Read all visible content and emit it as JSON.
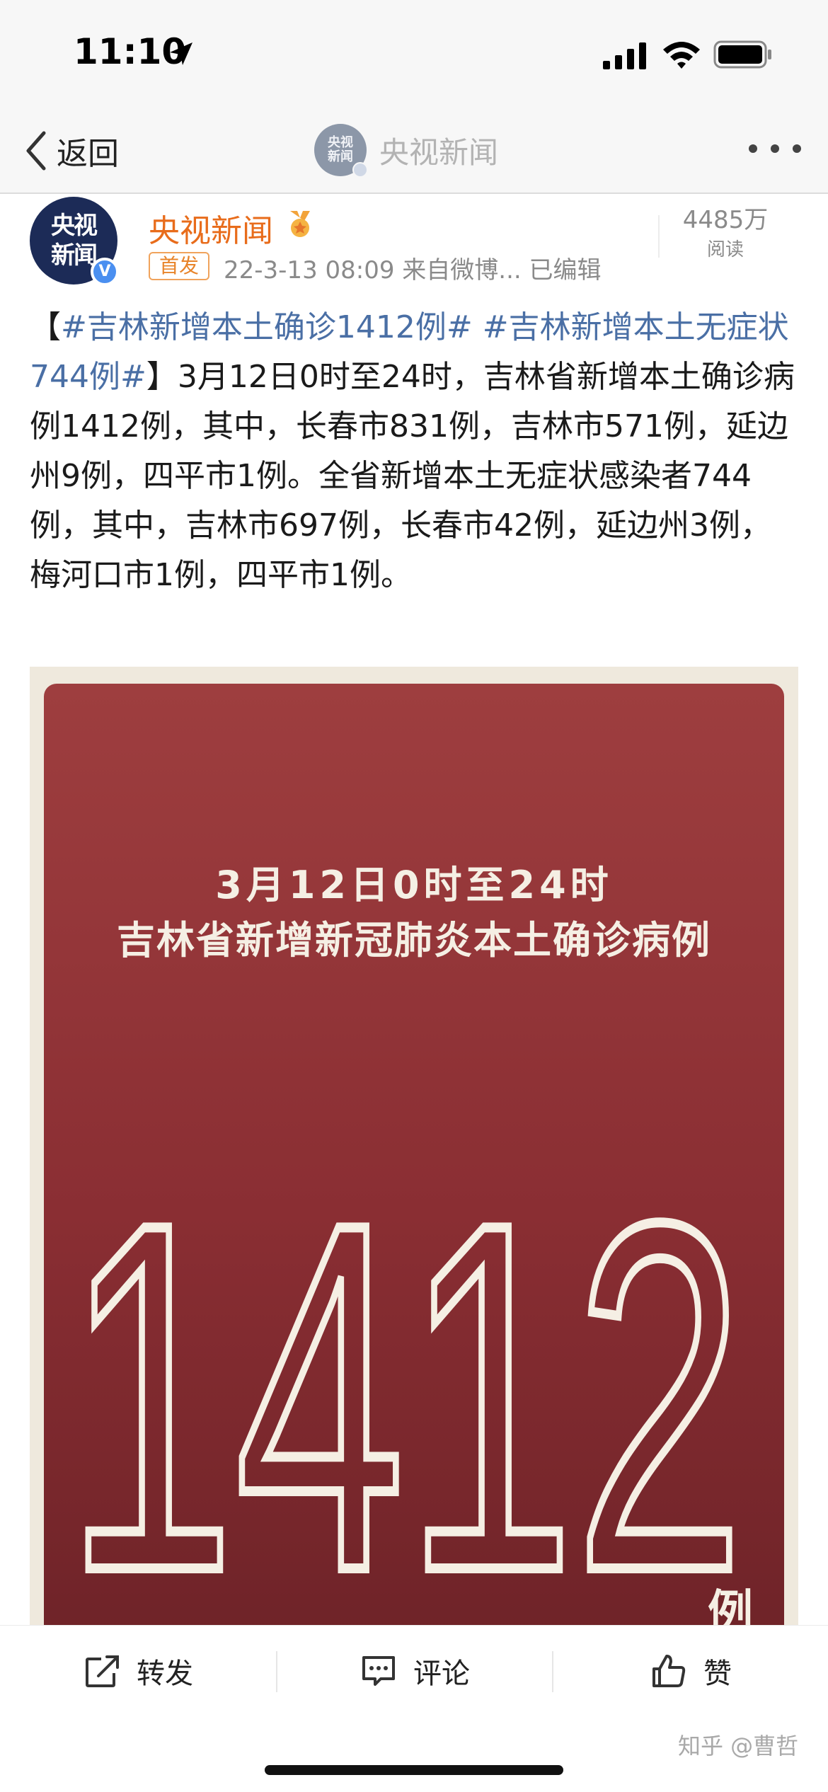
{
  "status_bar": {
    "time": "11:10"
  },
  "nav": {
    "back_label": "返回",
    "avatar_text": "央视新闻",
    "title": "央视新闻"
  },
  "post": {
    "avatar_text": "央视新闻",
    "verified_mark": "V",
    "author": "央视新闻",
    "first_tag": "首发",
    "meta": "22-3-13 08:09  来自微博...  已编辑",
    "read_count": "4485万",
    "read_label": "阅读",
    "text": {
      "bracket_open": "【",
      "hashtag1": "#吉林新增本土确诊1412例#",
      "space": " ",
      "hashtag2": "#吉林新增本土无症状744例#",
      "body": "】3月12日0时至24时，吉林省新增本土确诊病例1412例，其中，长春市831例，吉林市571例，延边州9例，四平市1例。全省新增本土无症状感染者744例，其中，吉林市697例，长春市42例，延边州3例，梅河口市1例，四平市1例。"
    }
  },
  "image": {
    "line1": "3月12日0时至24时",
    "line2": "吉林省新增新冠肺炎本土确诊病例",
    "number": "1412",
    "unit": "例"
  },
  "actions": {
    "repost": "转发",
    "comment": "评论",
    "like": "赞"
  },
  "watermark": "知乎 @曹哲",
  "colors": {
    "accent_orange": "#e86c1b",
    "hashtag_blue": "#4a6fa5",
    "image_red": "#8a2e33",
    "image_text": "#f5efe4"
  }
}
